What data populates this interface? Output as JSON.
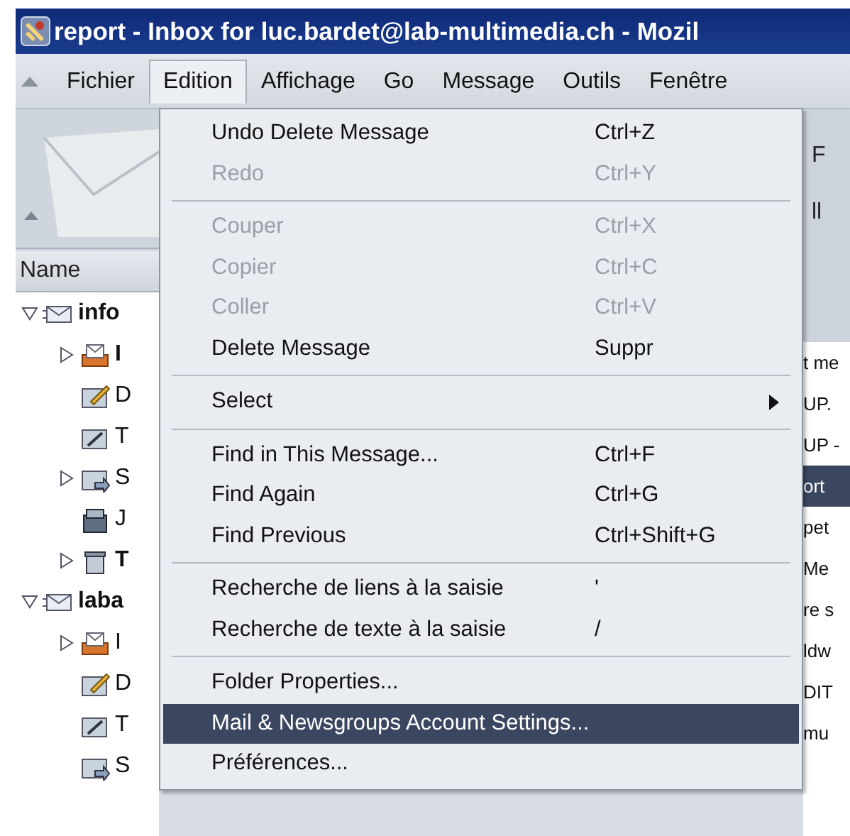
{
  "window": {
    "title": "report - Inbox for luc.bardet@lab-multimedia.ch - Mozil"
  },
  "menubar": [
    {
      "label": "Fichier",
      "selected": false
    },
    {
      "label": "Edition",
      "selected": true
    },
    {
      "label": "Affichage",
      "selected": false
    },
    {
      "label": "Go",
      "selected": false
    },
    {
      "label": "Message",
      "selected": false
    },
    {
      "label": "Outils",
      "selected": false
    },
    {
      "label": "Fenêtre",
      "selected": false
    }
  ],
  "dropdown": [
    {
      "kind": "item",
      "label": "Undo Delete Message",
      "shortcut": "Ctrl+Z",
      "disabled": false,
      "selected": false
    },
    {
      "kind": "item",
      "label": "Redo",
      "shortcut": "Ctrl+Y",
      "disabled": true,
      "selected": false
    },
    {
      "kind": "separator"
    },
    {
      "kind": "item",
      "label": "Couper",
      "shortcut": "Ctrl+X",
      "disabled": true,
      "selected": false
    },
    {
      "kind": "item",
      "label": "Copier",
      "shortcut": "Ctrl+C",
      "disabled": true,
      "selected": false
    },
    {
      "kind": "item",
      "label": "Coller",
      "shortcut": "Ctrl+V",
      "disabled": true,
      "selected": false
    },
    {
      "kind": "item",
      "label": "Delete Message",
      "shortcut": "Suppr",
      "disabled": false,
      "selected": false
    },
    {
      "kind": "separator"
    },
    {
      "kind": "submenu",
      "label": "Select",
      "disabled": false,
      "selected": false
    },
    {
      "kind": "separator"
    },
    {
      "kind": "item",
      "label": "Find in This Message...",
      "shortcut": "Ctrl+F",
      "disabled": false,
      "selected": false
    },
    {
      "kind": "item",
      "label": "Find Again",
      "shortcut": "Ctrl+G",
      "disabled": false,
      "selected": false
    },
    {
      "kind": "item",
      "label": "Find Previous",
      "shortcut": "Ctrl+Shift+G",
      "disabled": false,
      "selected": false
    },
    {
      "kind": "separator"
    },
    {
      "kind": "item",
      "label": "Recherche de liens à la saisie",
      "shortcut": "'",
      "disabled": false,
      "selected": false
    },
    {
      "kind": "item",
      "label": "Recherche de texte à la saisie",
      "shortcut": "/",
      "disabled": false,
      "selected": false
    },
    {
      "kind": "separator"
    },
    {
      "kind": "item",
      "label": "Folder Properties...",
      "disabled": false,
      "selected": false
    },
    {
      "kind": "item",
      "label": "Mail & Newsgroups Account Settings...",
      "disabled": false,
      "selected": true
    },
    {
      "kind": "item",
      "label": "Préférences...",
      "disabled": false,
      "selected": false
    }
  ],
  "folder_pane": {
    "header": "Name",
    "tree": [
      {
        "label": "info",
        "kind": "account",
        "bold": true,
        "expanded": true,
        "children": [
          {
            "label": "I",
            "kind": "inbox",
            "bold": true,
            "expanded": false
          },
          {
            "label": "D",
            "kind": "drafts",
            "bold": false
          },
          {
            "label": "T",
            "kind": "templates",
            "bold": false
          },
          {
            "label": "S",
            "kind": "sent",
            "bold": false,
            "expanded": false
          },
          {
            "label": "J",
            "kind": "junk",
            "bold": false
          },
          {
            "label": "T",
            "kind": "trash",
            "bold": true,
            "expanded": false
          }
        ]
      },
      {
        "label": "laba",
        "kind": "account",
        "bold": true,
        "expanded": true,
        "children": [
          {
            "label": "I",
            "kind": "inbox",
            "bold": false,
            "expanded": false
          },
          {
            "label": "D",
            "kind": "drafts",
            "bold": false
          },
          {
            "label": "T",
            "kind": "templates",
            "bold": false
          },
          {
            "label": "S",
            "kind": "sent",
            "bold": false
          }
        ]
      }
    ]
  },
  "toolbar_fragments": [
    "F",
    "ll"
  ],
  "message_list": [
    {
      "text": "t me",
      "selected": false
    },
    {
      "text": "UP.",
      "selected": false
    },
    {
      "text": "UP -",
      "selected": false
    },
    {
      "text": "ort",
      "selected": true
    },
    {
      "text": "pet",
      "selected": false
    },
    {
      "text": "Me",
      "selected": false
    },
    {
      "text": "re s",
      "selected": false
    },
    {
      "text": "ldw",
      "selected": false
    },
    {
      "text": "DIT",
      "selected": false
    },
    {
      "text": "mu",
      "selected": false
    }
  ]
}
